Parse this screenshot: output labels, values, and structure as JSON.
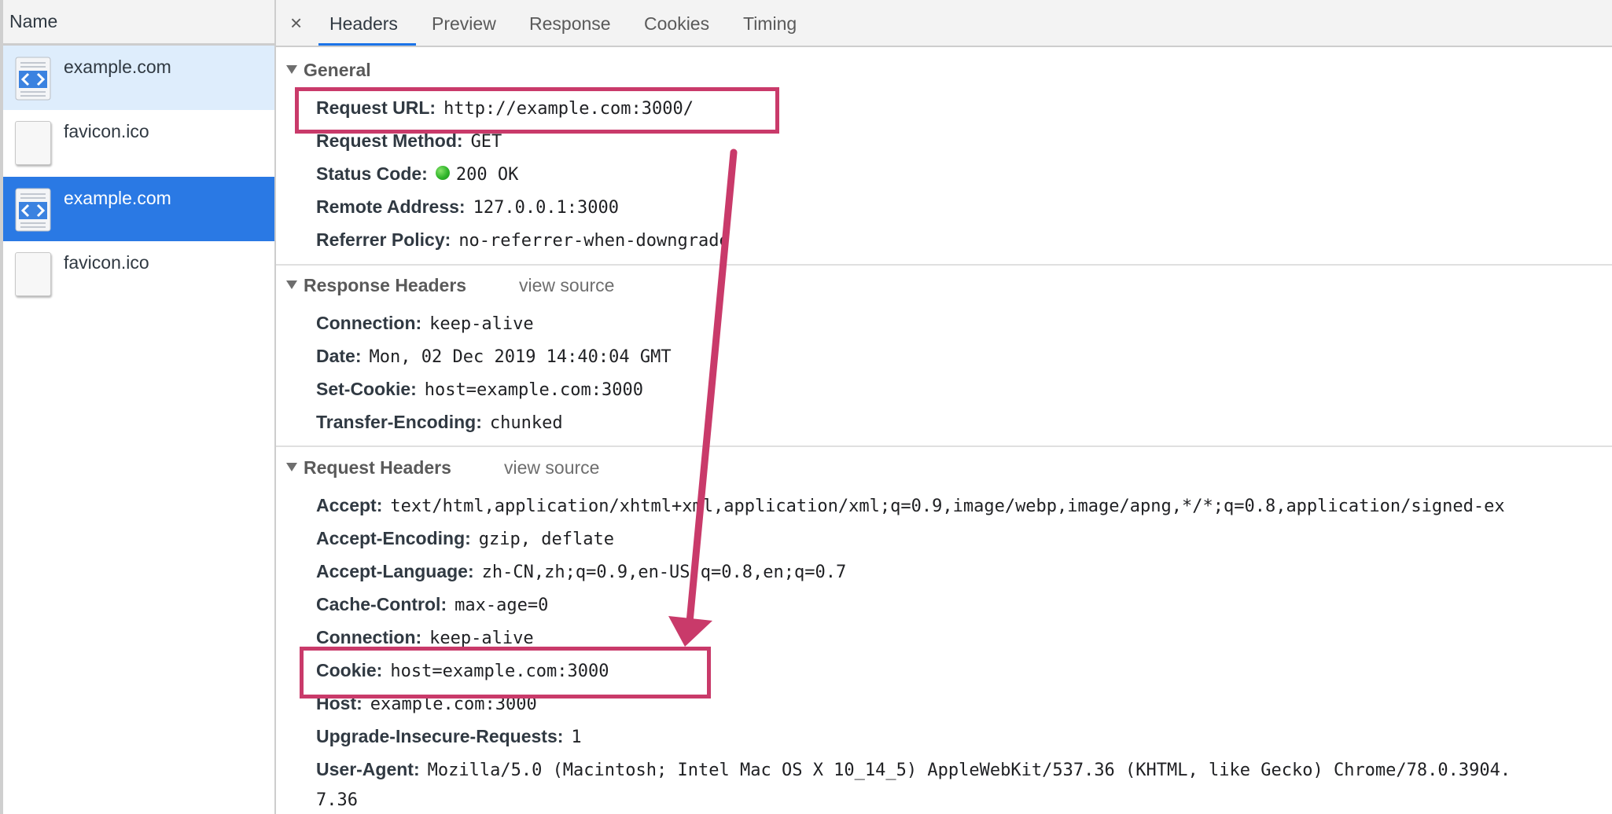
{
  "left_pane": {
    "header": "Name",
    "requests": [
      {
        "label": "example.com",
        "icon": "html-document-icon"
      },
      {
        "label": "favicon.ico",
        "icon": "blank-file-icon"
      },
      {
        "label": "example.com",
        "icon": "html-document-icon"
      },
      {
        "label": "favicon.ico",
        "icon": "blank-file-icon"
      }
    ]
  },
  "tabs": {
    "close": "×",
    "items": [
      "Headers",
      "Preview",
      "Response",
      "Cookies",
      "Timing"
    ],
    "active": "Headers"
  },
  "general": {
    "title": "General",
    "rows": [
      {
        "key": "Request URL:",
        "value": "http://example.com:3000/"
      },
      {
        "key": "Request Method:",
        "value": "GET"
      },
      {
        "key": "Status Code:",
        "value": "200 OK"
      },
      {
        "key": "Remote Address:",
        "value": "127.0.0.1:3000"
      },
      {
        "key": "Referrer Policy:",
        "value": "no-referrer-when-downgrade"
      }
    ]
  },
  "response_headers": {
    "title": "Response Headers",
    "view_source": "view source",
    "rows": [
      {
        "key": "Connection:",
        "value": "keep-alive"
      },
      {
        "key": "Date:",
        "value": "Mon, 02 Dec 2019 14:40:04 GMT"
      },
      {
        "key": "Set-Cookie:",
        "value": "host=example.com:3000"
      },
      {
        "key": "Transfer-Encoding:",
        "value": "chunked"
      }
    ]
  },
  "request_headers": {
    "title": "Request Headers",
    "view_source": "view source",
    "rows": [
      {
        "key": "Accept:",
        "value": "text/html,application/xhtml+xml,application/xml;q=0.9,image/webp,image/apng,*/*;q=0.8,application/signed-ex"
      },
      {
        "key": "Accept-Encoding:",
        "value": "gzip, deflate"
      },
      {
        "key": "Accept-Language:",
        "value": "zh-CN,zh;q=0.9,en-US;q=0.8,en;q=0.7"
      },
      {
        "key": "Cache-Control:",
        "value": "max-age=0"
      },
      {
        "key": "Connection:",
        "value": "keep-alive"
      },
      {
        "key": "Cookie:",
        "value": "host=example.com:3000"
      },
      {
        "key": "Host:",
        "value": "example.com:3000"
      },
      {
        "key": "Upgrade-Insecure-Requests:",
        "value": "1"
      },
      {
        "key": "User-Agent:",
        "value": "Mozilla/5.0 (Macintosh; Intel Mac OS X 10_14_5) AppleWebKit/537.36 (KHTML, like Gecko) Chrome/78.0.3904."
      }
    ],
    "user_agent_wrap": "7.36"
  },
  "colors": {
    "highlight": "#c93a6a",
    "selected_row": "#2a79e4",
    "light_row": "#deedfc",
    "tab_underline": "#1a73e8",
    "status_ok": "#2fb52a"
  }
}
